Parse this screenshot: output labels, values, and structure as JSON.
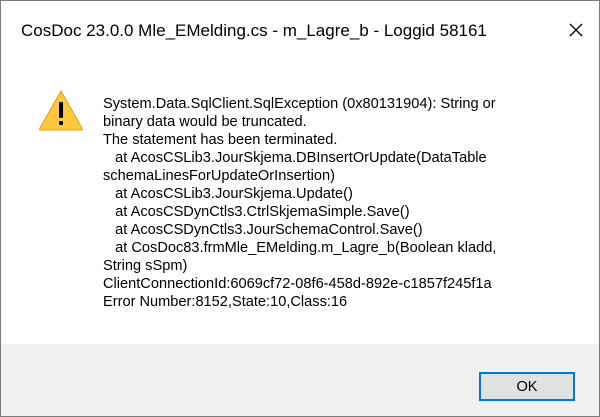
{
  "dialog": {
    "title": "CosDoc 23.0.0  Mle_EMelding.cs - m_Lagre_b -  Loggid 58161",
    "close_icon": "close-icon",
    "warning_icon": "warning-icon",
    "accent_color": "#0078d7",
    "warning_color": "#ffc83d",
    "message_lines": [
      "System.Data.SqlClient.SqlException (0x80131904): String or",
      "binary data would be truncated.",
      "The statement has been terminated.",
      "   at AcosCSLib3.JourSkjema.DBInsertOrUpdate(DataTable",
      "schemaLinesForUpdateOrInsertion)",
      "   at AcosCSLib3.JourSkjema.Update()",
      "   at AcosCSDynCtls3.CtrlSkjemaSimple.Save()",
      "   at AcosCSDynCtls3.JourSchemaControl.Save()",
      "   at CosDoc83.frmMle_EMelding.m_Lagre_b(Boolean kladd,",
      "String sSpm)",
      "ClientConnectionId:6069cf72-08f6-458d-892e-c1857f245f1a",
      "Error Number:8152,State:10,Class:16"
    ],
    "ok_label": "OK"
  }
}
